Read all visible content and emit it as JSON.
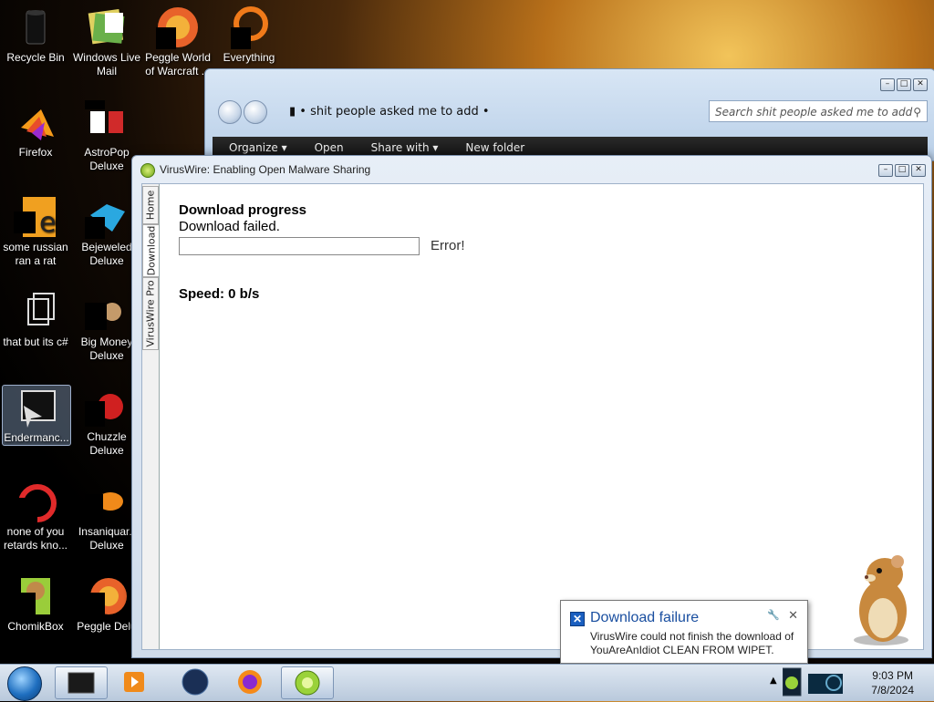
{
  "desktop_icons": [
    {
      "label": "Recycle Bin"
    },
    {
      "label": "Windows Live Mail"
    },
    {
      "label": "Peggle World of Warcraft ..."
    },
    {
      "label": "Everything"
    },
    {
      "label": "Firefox"
    },
    {
      "label": "AstroPop Deluxe"
    },
    {
      "label": "some russian ran a rat"
    },
    {
      "label": "Bejeweled Deluxe"
    },
    {
      "label": "that but its c#"
    },
    {
      "label": "Big Money Deluxe"
    },
    {
      "label": "Endermanc..."
    },
    {
      "label": "Chuzzle Deluxe"
    },
    {
      "label": "none of you retards kno..."
    },
    {
      "label": "Insaniquar.. Deluxe"
    },
    {
      "label": "ChomikBox"
    },
    {
      "label": "Peggle Delu"
    }
  ],
  "explorer": {
    "path": "shit people asked me to add",
    "search_placeholder": "Search shit people asked me to add",
    "toolbar": {
      "organize": "Organize ▾",
      "open": "Open",
      "share": "Share with ▾",
      "new_folder": "New folder"
    }
  },
  "viruswire": {
    "title": "VirusWire: Enabling Open Malware Sharing",
    "tabs": [
      "Home",
      "Download",
      "VirusWire Pro"
    ],
    "download_progress": "Download progress",
    "status": "Download failed.",
    "progress_value": 0,
    "error_label": "Error!",
    "speed": "Speed: 0 b/s"
  },
  "notification": {
    "title": "Download failure",
    "body": "VirusWire could not finish the download of YouAreAnIdiot CLEAN FROM WIPET."
  },
  "taskbar": {
    "time": "9:03 PM",
    "date": "7/8/2024"
  },
  "colors": {
    "accent": "#1a4fa0",
    "progress": "#3cbf4a"
  }
}
